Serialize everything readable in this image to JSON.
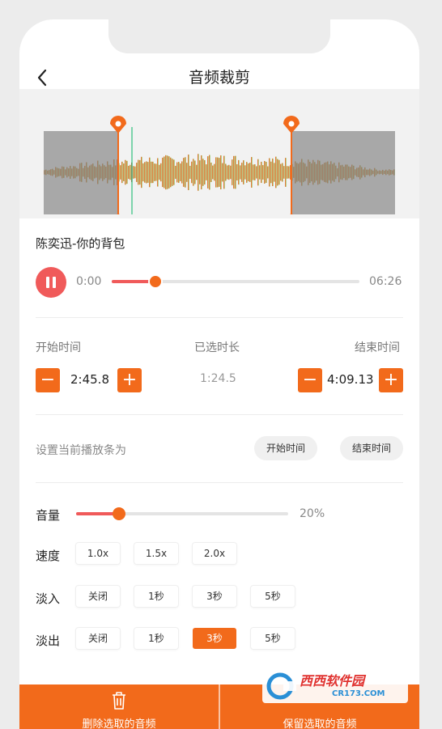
{
  "header": {
    "title": "音频裁剪",
    "back_icon": "chevron-left-icon"
  },
  "player": {
    "song": "陈奕迅-你的背包",
    "current_time": "0:00",
    "total_time": "06:26",
    "progress_fraction": 0.14
  },
  "trim": {
    "start_label": "开始时间",
    "selected_label": "已选时长",
    "end_label": "结束时间",
    "start_value": "2:45.8",
    "selected_value": "1:24.5",
    "end_value": "4:09.13",
    "minus": "−",
    "plus": "+"
  },
  "set_current": {
    "label": "设置当前播放条为",
    "start_btn": "开始时间",
    "end_btn": "结束时间"
  },
  "volume": {
    "label": "音量",
    "value": "20%",
    "fraction": 0.2
  },
  "speed": {
    "label": "速度",
    "options": [
      "1.0x",
      "1.5x",
      "2.0x"
    ]
  },
  "fade_in": {
    "label": "淡入",
    "options": [
      "关闭",
      "1秒",
      "3秒",
      "5秒"
    ]
  },
  "fade_out": {
    "label": "淡出",
    "options": [
      "关闭",
      "1秒",
      "3秒",
      "5秒"
    ],
    "selected": "3秒"
  },
  "bottom": {
    "delete_label": "删除选取的音频",
    "save_label": "保留选取的音频"
  },
  "watermark": {
    "logo": "西西软件园",
    "site": "CR173.COM"
  },
  "colors": {
    "accent": "#f26a1b",
    "play": "#f05a5a"
  }
}
